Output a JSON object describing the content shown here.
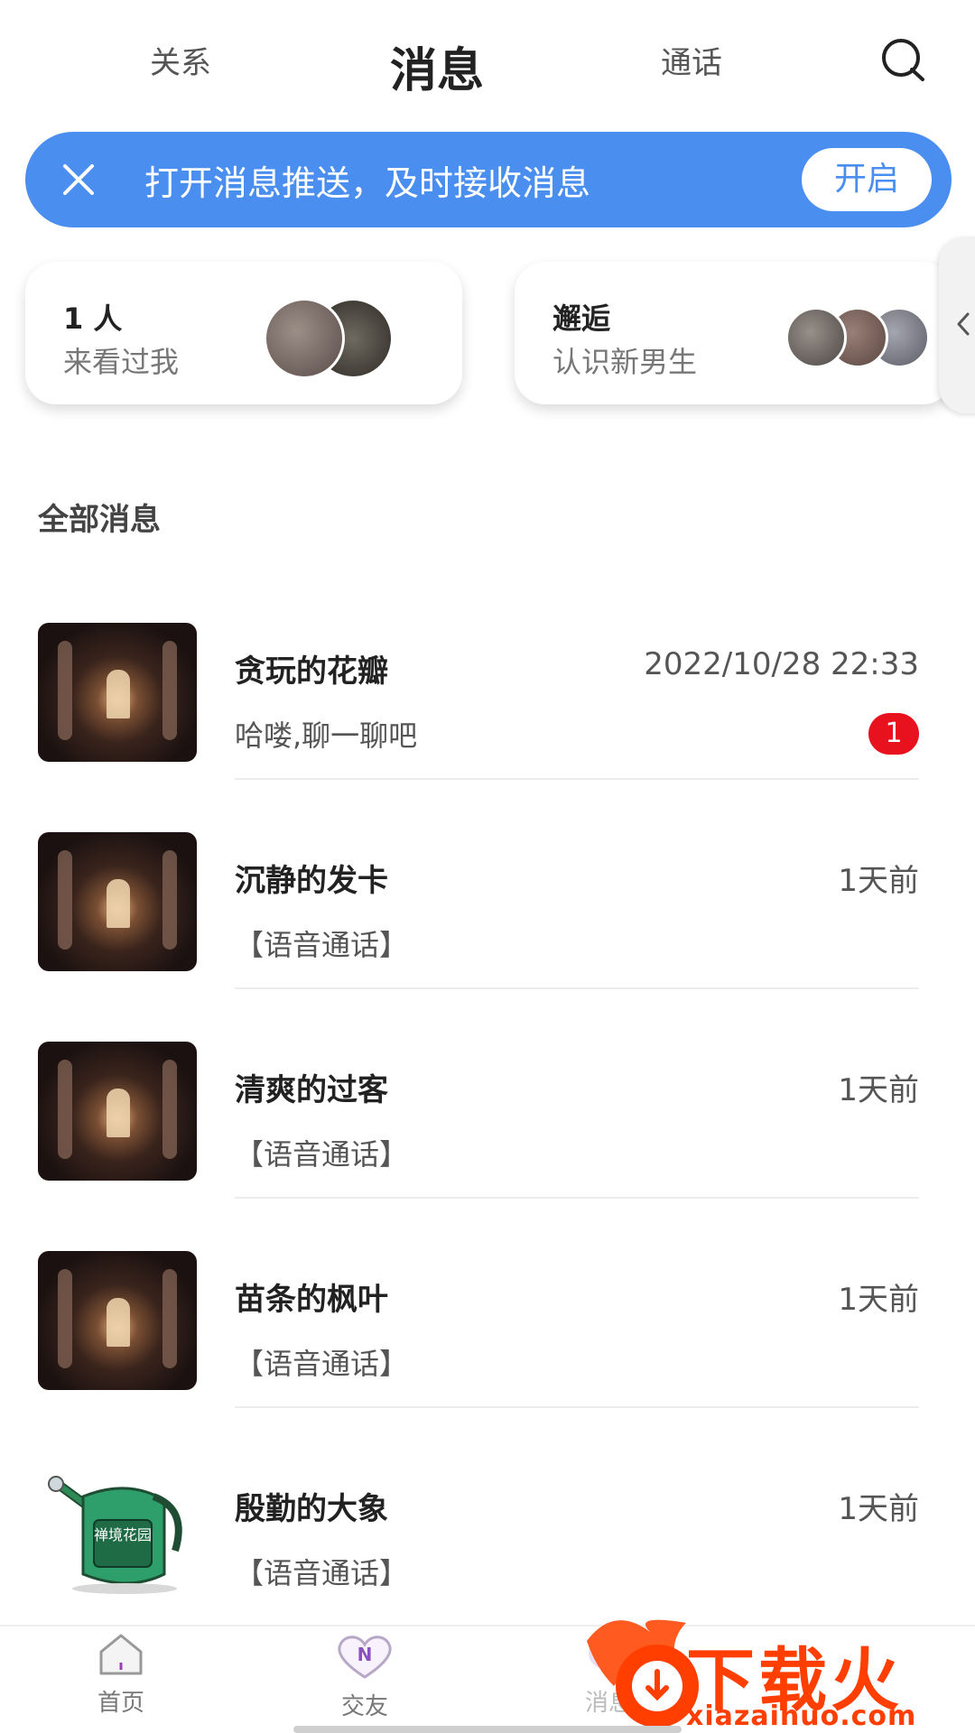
{
  "topnav": {
    "tabs": [
      {
        "label": "关系"
      },
      {
        "label": "消息"
      },
      {
        "label": "通话"
      }
    ],
    "search_icon": "search-icon"
  },
  "banner": {
    "text": "打开消息推送，及时接收消息",
    "button": "开启",
    "close_icon": "close-icon",
    "color": "#4a8ef0"
  },
  "cards": [
    {
      "title": "1 人",
      "subtitle": "来看过我"
    },
    {
      "title": "邂逅",
      "subtitle": "认识新男生"
    }
  ],
  "side_handle_icon": "chevron-left-icon",
  "section_title": "全部消息",
  "messages": [
    {
      "name": "贪玩的花瓣",
      "time": "2022/10/28 22:33",
      "preview": "哈喽,聊一聊吧",
      "badge": "1"
    },
    {
      "name": "沉静的发卡",
      "time": "1天前",
      "preview": "【语音通话】"
    },
    {
      "name": "清爽的过客",
      "time": "1天前",
      "preview": "【语音通话】"
    },
    {
      "name": "苗条的枫叶",
      "time": "1天前",
      "preview": "【语音通话】"
    },
    {
      "name": "殷勤的大象",
      "time": "1天前",
      "preview": "【语音通话】",
      "avatar_text": "禅境花园"
    }
  ],
  "bottom_nav": [
    {
      "label": "首页",
      "icon": "home-icon"
    },
    {
      "label": "交友",
      "icon": "heart-icon"
    },
    {
      "label": "消息",
      "icon": "message-icon"
    }
  ],
  "watermark": {
    "text": "下载火",
    "url": "xiazaihuo.com"
  }
}
